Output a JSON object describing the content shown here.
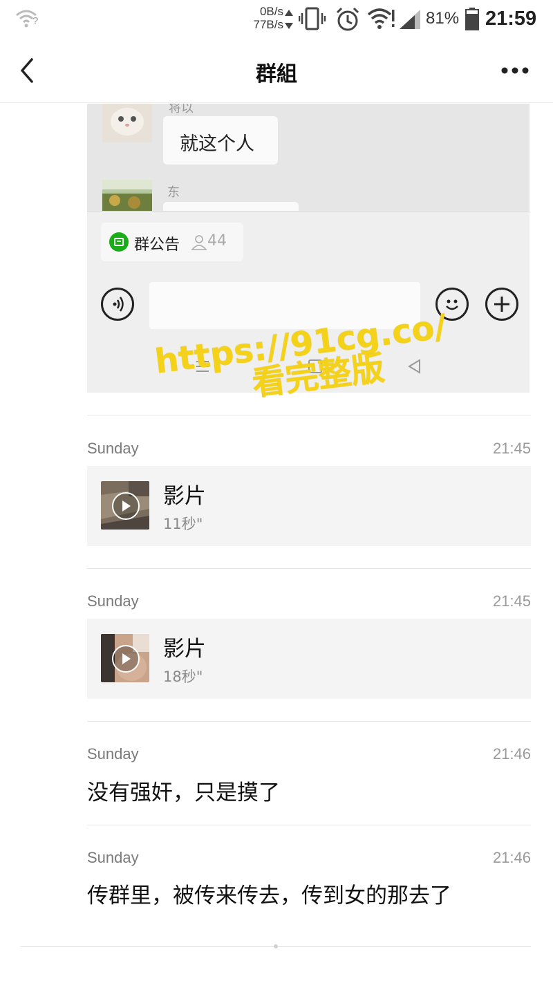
{
  "status_bar": {
    "net_down": "0B/s",
    "net_up": "77B/s",
    "battery_percent": "81%",
    "time": "21:59",
    "wifi_question": "?",
    "icons": [
      "wifi-unknown-icon",
      "data-arrows-icon",
      "vibrate-icon",
      "alarm-icon",
      "wifi-icon",
      "signal-icon",
      "battery-icon"
    ]
  },
  "header": {
    "back_icon": "back-chevron-icon",
    "title": "群組",
    "more_icon": "more-dots-icon"
  },
  "embedded_shot": {
    "msg1_sender": "将以",
    "msg1_text": "就这个人",
    "msg2_sender": "东",
    "notice_label": "群公告",
    "member_count": "44",
    "icons": [
      "voice-icon",
      "emoji-icon",
      "add-icon",
      "menu-icon",
      "home-icon",
      "back-triangle-icon"
    ]
  },
  "watermark": {
    "line1": "https://91cg.co/",
    "line2": "看完整版",
    "color": "#f5d21a"
  },
  "records": [
    {
      "day": "Sunday",
      "time": "21:45",
      "type": "video",
      "label": "影片",
      "duration": "11秒\""
    },
    {
      "day": "Sunday",
      "time": "21:45",
      "type": "video",
      "label": "影片",
      "duration": "18秒\""
    },
    {
      "day": "Sunday",
      "time": "21:46",
      "type": "text",
      "text": "没有强奸，只是摸了"
    },
    {
      "day": "Sunday",
      "time": "21:46",
      "type": "text",
      "text": "传群里，被传来传去，传到女的那去了"
    }
  ]
}
